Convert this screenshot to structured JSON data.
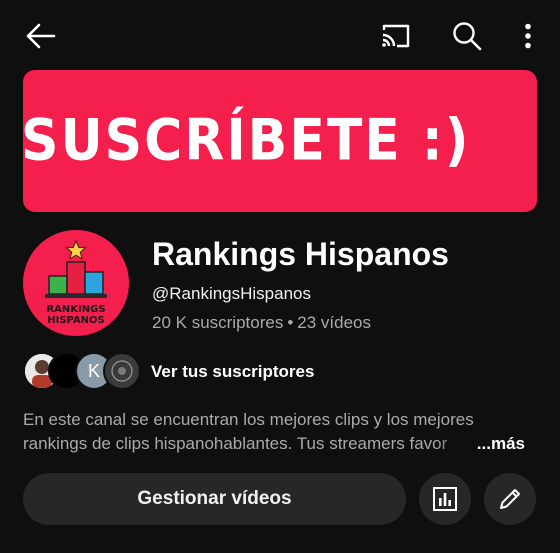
{
  "topbar": {
    "icons": [
      "back-arrow-icon",
      "cast-icon",
      "search-icon",
      "more-vert-icon"
    ]
  },
  "banner": {
    "text": "SUSCRÍBETE :)",
    "background": "#f51f4d"
  },
  "channel": {
    "avatar_text_line1": "RANKINGS",
    "avatar_text_line2": "HISPANOS",
    "name": "Rankings Hispanos",
    "handle": "@RankingsHispanos",
    "subscribers": "20 K suscriptores",
    "separator": "•",
    "videos": "23 vídeos"
  },
  "subscribers_row": {
    "avatar3_letter": "K",
    "label": "Ver tus suscriptores"
  },
  "description": {
    "line1": "En este canal se encuentran los mejores clips y los mejores",
    "line2": "rankings de clips hispanohablantes. Tus streamers favor",
    "more": "...más"
  },
  "actions": {
    "manage_videos": "Gestionar vídeos",
    "analytics_icon": "bar-chart-icon",
    "edit_icon": "pencil-icon"
  }
}
